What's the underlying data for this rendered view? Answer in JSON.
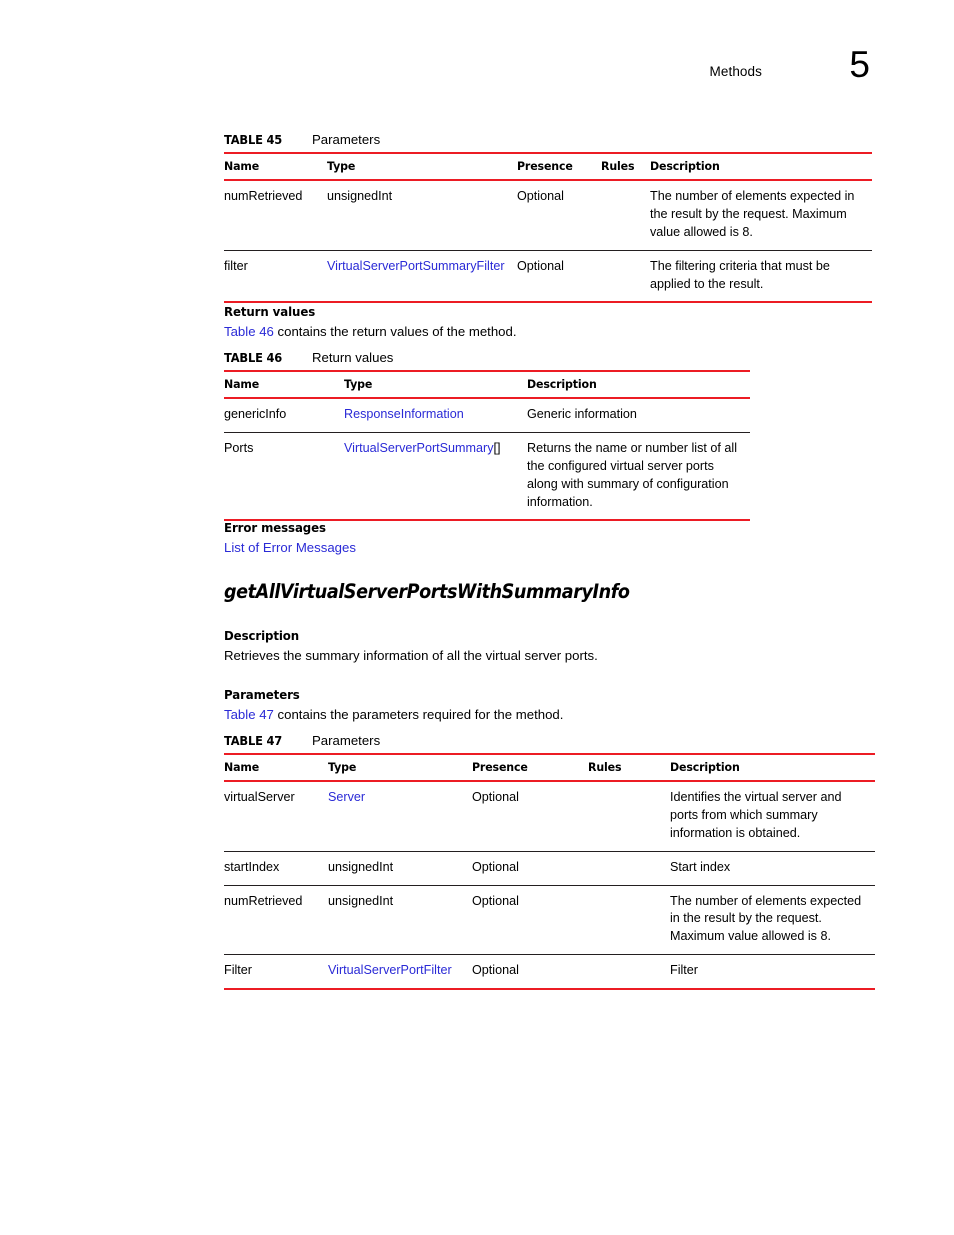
{
  "header": {
    "running_label": "Methods",
    "chapter_number": "5"
  },
  "colors": {
    "rule_red": "#ec1c24",
    "link_blue": "#2a2ad6",
    "text_black": "#000000"
  },
  "table45": {
    "caption_number": "TABLE 45",
    "caption_title": "Parameters",
    "columns": [
      "Name",
      "Type",
      "Presence",
      "Rules",
      "Description"
    ],
    "rows": [
      {
        "name": "numRetrieved",
        "type": "unsignedInt",
        "type_is_link": false,
        "presence": "Optional",
        "rules": "",
        "description": "The number of elements expected in the result by the request. Maximum value allowed is 8."
      },
      {
        "name": "filter",
        "type": "VirtualServerPortSummaryFilter",
        "type_is_link": true,
        "presence": "Optional",
        "rules": "",
        "description": "The filtering criteria that must be applied to the result."
      }
    ]
  },
  "return_values_section": {
    "heading": "Return values",
    "intro_link": "Table 46",
    "intro_rest": " contains the return values of the method."
  },
  "table46": {
    "caption_number": "TABLE 46",
    "caption_title": "Return values",
    "columns": [
      "Name",
      "Type",
      "Description"
    ],
    "rows": [
      {
        "name": "genericInfo",
        "type": "ResponseInformation",
        "type_suffix": "",
        "type_is_link": true,
        "description": "Generic information"
      },
      {
        "name": "Ports",
        "type": "VirtualServerPortSummary",
        "type_suffix": "[]",
        "type_is_link": true,
        "description": "Returns the name or number list of all the configured virtual server ports along with summary of configuration information."
      }
    ]
  },
  "error_section": {
    "heading": "Error messages",
    "link": "List of Error Messages"
  },
  "method": {
    "name": "getAllVirtualServerPortsWithSummaryInfo"
  },
  "description_section": {
    "heading": "Description",
    "text": "Retrieves the summary information of all the virtual server ports."
  },
  "parameters_section": {
    "heading": "Parameters",
    "intro_link": "Table 47",
    "intro_rest": " contains the parameters required for the method."
  },
  "table47": {
    "caption_number": "TABLE 47",
    "caption_title": "Parameters",
    "columns": [
      "Name",
      "Type",
      "Presence",
      "Rules",
      "Description"
    ],
    "rows": [
      {
        "name": "virtualServer",
        "type": "Server",
        "type_is_link": true,
        "presence": "Optional",
        "rules": "",
        "description": "Identifies the virtual server and ports from which summary information is obtained."
      },
      {
        "name": "startIndex",
        "type": "unsignedInt",
        "type_is_link": false,
        "presence": "Optional",
        "rules": "",
        "description": "Start index"
      },
      {
        "name": "numRetrieved",
        "type": "unsignedInt",
        "type_is_link": false,
        "presence": "Optional",
        "rules": "",
        "description": "The number of elements expected in the result by the request. Maximum value allowed is 8."
      },
      {
        "name": "Filter",
        "type": "VirtualServerPortFilter",
        "type_is_link": true,
        "presence": "Optional",
        "rules": "",
        "description": "Filter"
      }
    ]
  }
}
